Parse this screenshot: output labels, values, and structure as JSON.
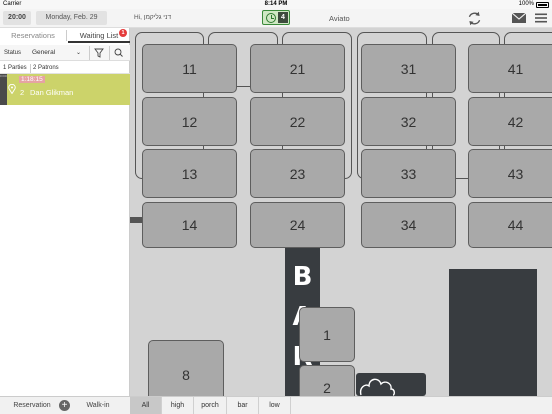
{
  "status_bar": {
    "carrier": "Carrier",
    "time": "8:14 PM",
    "battery": "100%"
  },
  "header": {
    "time": "20:00",
    "date": "Monday, Feb. 29",
    "greeting": "Hi, דני גליקמן",
    "waiting_count": "4",
    "restaurant": "Aviato",
    "icons": [
      "clock-icon",
      "refresh-icon",
      "mail-icon",
      "menu-icon"
    ]
  },
  "left_panel": {
    "tabs": [
      {
        "label": "Reservations",
        "active": false
      },
      {
        "label": "Waiting List",
        "active": true,
        "badge": "1"
      }
    ],
    "filter": {
      "status_label": "Status",
      "status_value": "General"
    },
    "counts": {
      "parties": "1 Parties",
      "patrons": "2 Patrons"
    },
    "waiting_list": [
      {
        "elapsed": "1:18:15",
        "party_size": "2",
        "name": "Dan Glikman",
        "color": "#ccd36a"
      }
    ]
  },
  "floor": {
    "tables": [
      "11",
      "21",
      "31",
      "41",
      "12",
      "22",
      "32",
      "42",
      "13",
      "23",
      "33",
      "43",
      "14",
      "24",
      "34",
      "44",
      "1",
      "2",
      "8"
    ],
    "bar_sign": [
      "B",
      "A",
      "R"
    ]
  },
  "bottom_bar": {
    "reservation_label": "Reservation",
    "add_label": "+",
    "walkin_label": "Walk-in",
    "areas": [
      {
        "label": "All",
        "active": true
      },
      {
        "label": "high",
        "active": false
      },
      {
        "label": "porch",
        "active": false
      },
      {
        "label": "bar",
        "active": false
      },
      {
        "label": "low",
        "active": false
      }
    ]
  }
}
